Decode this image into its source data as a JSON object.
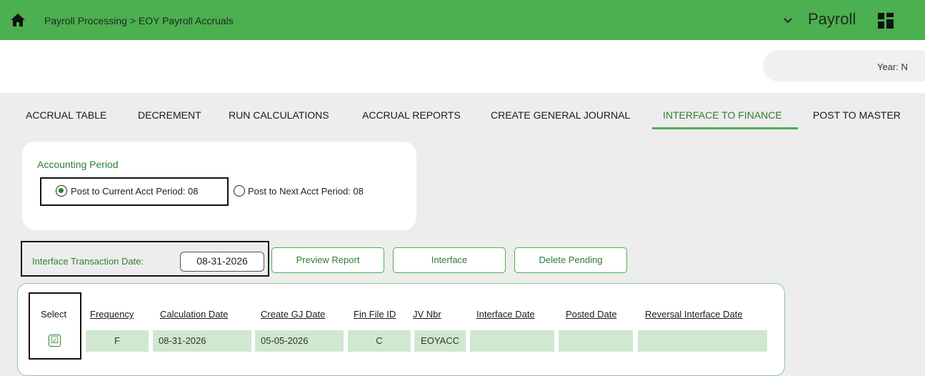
{
  "topbar": {
    "breadcrumb": "Payroll Processing > EOY Payroll Accruals",
    "app_name": "Payroll",
    "home_icon": "home-icon",
    "dropdown_icon": "chevron-down-icon",
    "apps_icon": "grid-icon",
    "color": "#4caf50"
  },
  "header": {
    "year_label": "Year: N"
  },
  "tabs": [
    {
      "label": "ACCRUAL TABLE"
    },
    {
      "label": "DECREMENT"
    },
    {
      "label": "RUN CALCULATIONS"
    },
    {
      "label": "ACCRUAL REPORTS"
    },
    {
      "label": "CREATE GENERAL JOURNAL"
    },
    {
      "label": "INTERFACE TO FINANCE",
      "active": true
    },
    {
      "label": "POST TO MASTER"
    }
  ],
  "accounting_period": {
    "title": "Accounting Period",
    "options": [
      {
        "label": "Post to Current Acct Period: 08",
        "selected": true
      },
      {
        "label": "Post to Next Acct Period: 08",
        "selected": false
      }
    ]
  },
  "interface": {
    "date_label": "Interface Transaction Date:",
    "date_value": "08-31-2026",
    "buttons": [
      "Preview Report",
      "Interface",
      "Delete Pending"
    ]
  },
  "table": {
    "headers": [
      "Select",
      "Frequency",
      "Calculation Date",
      "Create GJ Date",
      "Fin File ID",
      "JV Nbr",
      "Interface Date",
      "Posted Date",
      "Reversal Interface Date"
    ],
    "rows": [
      {
        "select": "☑",
        "frequency": "F",
        "calculation_date": "08-31-2026",
        "create_gj_date": "05-05-2026",
        "fin_file_id": "C",
        "jv_nbr": "EOYACC",
        "interface_date": "",
        "posted_date": "",
        "reversal_interface_date": ""
      }
    ]
  }
}
